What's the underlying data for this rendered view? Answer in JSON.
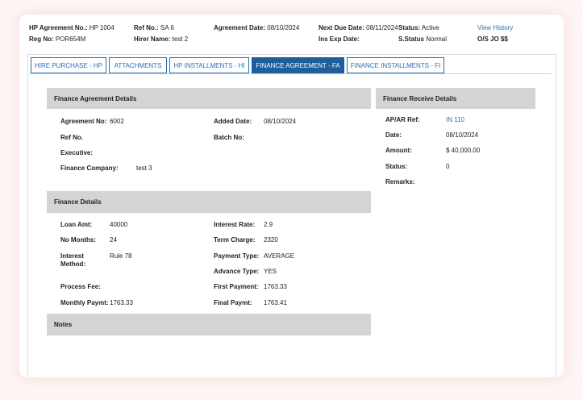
{
  "header": {
    "agreement_no_label": "HP Agreement No.:",
    "agreement_no": "HP 1004",
    "ref_no_label": "Ref No.:",
    "ref_no": "SA 6",
    "agreement_date_label": "Agreement Date:",
    "agreement_date": "08/10/2024",
    "next_due_label": "Next Due Date:",
    "next_due": "08/11/2024",
    "status_label": "Status:",
    "status": "Active",
    "view_history": "View History",
    "reg_no_label": "Reg No:",
    "reg_no": "POR654M",
    "hirer_name_label": "Hirer Name:",
    "hirer_name": "test 2",
    "ins_exp_label": "Ins Exp Date:",
    "ins_exp": "",
    "s_status_label": "S.Status",
    "s_status": "Normal",
    "os_label": "O/S JO $$"
  },
  "tabs": [
    {
      "label": "HIRE PURCHASE - HP"
    },
    {
      "label": "ATTACHMENTS"
    },
    {
      "label": "HP INSTALLMENTS - HI"
    },
    {
      "label": "FINANCE AGREEMENT - FA"
    },
    {
      "label": "FINANCE INSTALLMENTS - FI"
    }
  ],
  "finance_agreement": {
    "title": "Finance Agreement Details",
    "agreement_no_label": "Agreement No:",
    "agreement_no": "6002",
    "added_date_label": "Added Date:",
    "added_date": "08/10/2024",
    "ref_no_label": "Ref No.",
    "ref_no": "",
    "batch_no_label": "Batch No:",
    "batch_no": "",
    "executive_label": "Executive:",
    "executive": "",
    "finance_company_label": "Finance Company:",
    "finance_company": "test 3"
  },
  "finance_receive": {
    "title": "Finance Receive Details",
    "apar_label": "AP/AR Ref:",
    "apar": "IN 110",
    "date_label": "Date:",
    "date": "08/10/2024",
    "amount_label": "Amount:",
    "amount": "$ 40,000.00",
    "status_label": "Status:",
    "status": "0",
    "remarks_label": "Remarks:",
    "remarks": ""
  },
  "finance_details": {
    "title": "Finance Details",
    "loan_amt_label": "Loan Amt:",
    "loan_amt": "40000",
    "interest_rate_label": "Interest Rate:",
    "interest_rate": "2.9",
    "no_months_label": "No Months:",
    "no_months": "24",
    "term_charge_label": "Term Charge:",
    "term_charge": "2320",
    "interest_method_label_1": "Interest",
    "interest_method_label_2": "Method:",
    "interest_method": "Rule 78",
    "payment_type_label": "Payment Type:",
    "payment_type": "AVERAGE",
    "advance_type_label": "Advance Type:",
    "advance_type": "YES",
    "process_fee_label": "Process Fee:",
    "process_fee": "",
    "first_payment_label": "First Payment:",
    "first_payment": "1763.33",
    "monthly_paymt_label": "Monthly Paymt:",
    "monthly_paymt": "1763.33",
    "final_paymt_label": "Final Paymt:",
    "final_paymt": "1763.41"
  },
  "notes": {
    "title": "Notes"
  }
}
